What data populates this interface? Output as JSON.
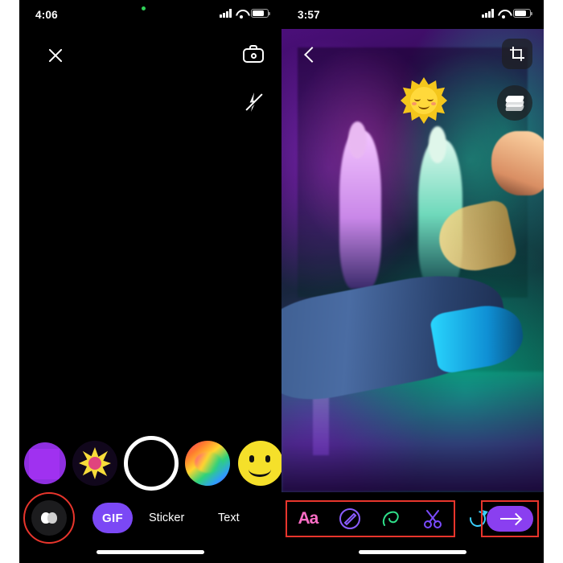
{
  "left_phone": {
    "status_bar": {
      "time": "4:06",
      "recording_dot": "green-dot",
      "signal_icon": "cellular-signal-icon",
      "wifi_icon": "wifi-icon",
      "battery_icon": "battery-icon"
    },
    "close_label": "close-icon",
    "camera_flip_label": "camera-flip-icon",
    "flash_label": "flash-off-icon",
    "effects": [
      {
        "name": "purple-square-effect"
      },
      {
        "name": "star-burst-effect"
      },
      {
        "name": "shutter-button"
      },
      {
        "name": "rainbow-swirl-effect"
      },
      {
        "name": "smiley-effect"
      }
    ],
    "tabs": [
      {
        "label": "",
        "name": "effects-tab",
        "highlighted": true
      },
      {
        "label": "GIF",
        "name": "gif-tab"
      },
      {
        "label": "Sticker",
        "name": "sticker-tab"
      },
      {
        "label": "Text",
        "name": "text-tab"
      }
    ]
  },
  "right_phone": {
    "status_bar": {
      "time": "3:57",
      "signal_icon": "cellular-signal-icon",
      "wifi_icon": "wifi-icon",
      "battery_icon": "battery-icon"
    },
    "back_label": "back-icon",
    "crop_label": "crop-icon",
    "layers_label": "layers-icon",
    "sticker": "sun-sticker",
    "edit_tools": [
      {
        "label": "Aa",
        "name": "text-tool",
        "color": "#ff6ec7"
      },
      {
        "label": "",
        "name": "pen-tool",
        "color": "#8a5cff"
      },
      {
        "label": "",
        "name": "brush-tool",
        "color": "#2fe08a"
      },
      {
        "label": "",
        "name": "scissors-tool",
        "color": "#7a4bff"
      }
    ],
    "redo_label": "redo-icon",
    "send_label": "send-arrow-icon"
  },
  "annotations": {
    "highlight_color": "#e8352c"
  }
}
